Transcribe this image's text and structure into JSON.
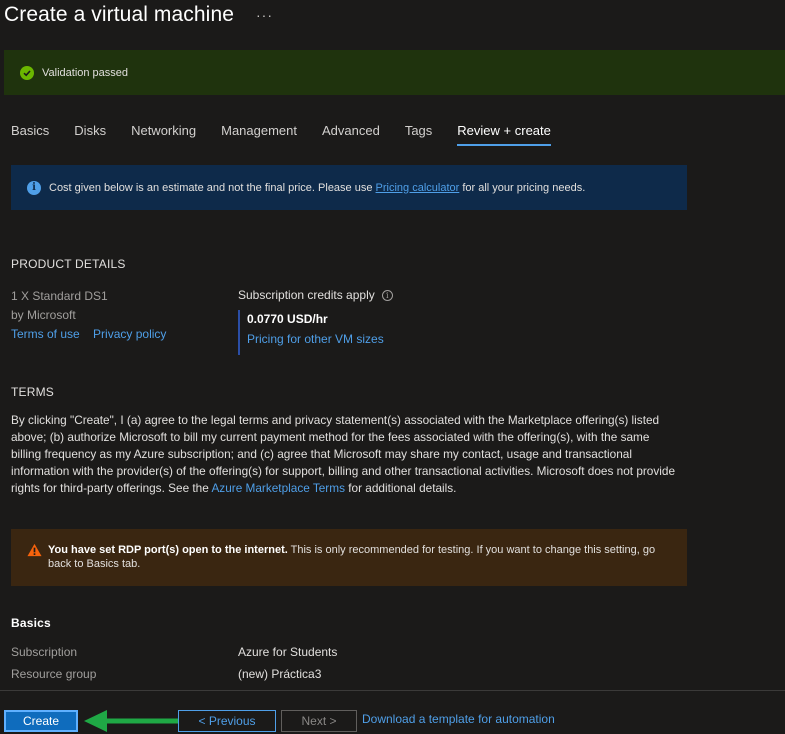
{
  "page": {
    "title": "Create a virtual machine",
    "more": "···"
  },
  "validation": {
    "text": "Validation passed"
  },
  "tabs": [
    {
      "label": "Basics"
    },
    {
      "label": "Disks"
    },
    {
      "label": "Networking"
    },
    {
      "label": "Management"
    },
    {
      "label": "Advanced"
    },
    {
      "label": "Tags"
    },
    {
      "label": "Review + create"
    }
  ],
  "info_banner": {
    "before": "Cost given below is an estimate and not the final price. Please use ",
    "link": "Pricing calculator",
    "after": " for all your pricing needs."
  },
  "product": {
    "heading": "PRODUCT DETAILS",
    "name": "1 X Standard DS1",
    "by": "by Microsoft",
    "terms_link": "Terms of use",
    "privacy_link": "Privacy policy",
    "credits_label": "Subscription credits apply",
    "price": "0.0770 USD/hr",
    "pricing_link": "Pricing for other VM sizes"
  },
  "terms": {
    "heading": "TERMS",
    "body_before": "By clicking \"Create\", I (a) agree to the legal terms and privacy statement(s) associated with the Marketplace offering(s) listed above; (b) authorize Microsoft to bill my current payment method for the fees associated with the offering(s), with the same billing frequency as my Azure subscription; and (c) agree that Microsoft may share my contact, usage and transactional information with the provider(s) of the offering(s) for support, billing and other transactional activities. Microsoft does not provide rights for third-party offerings. See the ",
    "link": "Azure Marketplace Terms",
    "body_after": " for additional details."
  },
  "warning": {
    "bold": "You have set RDP port(s) open to the internet.",
    "text": " This is only recommended for testing.  If you want to change this setting, go back to Basics tab."
  },
  "basics": {
    "heading": "Basics",
    "rows": [
      {
        "key": "Subscription",
        "value": "Azure for Students"
      },
      {
        "key": "Resource group",
        "value": "(new) Práctica3"
      }
    ]
  },
  "footer": {
    "create": "Create",
    "previous": "< Previous",
    "next": "Next >",
    "download": "Download a template for automation"
  },
  "colors": {
    "accent": "#4f9fe8",
    "success": "#6bb700",
    "warning": "#f7630c",
    "annotation_arrow": "#1fa845"
  }
}
